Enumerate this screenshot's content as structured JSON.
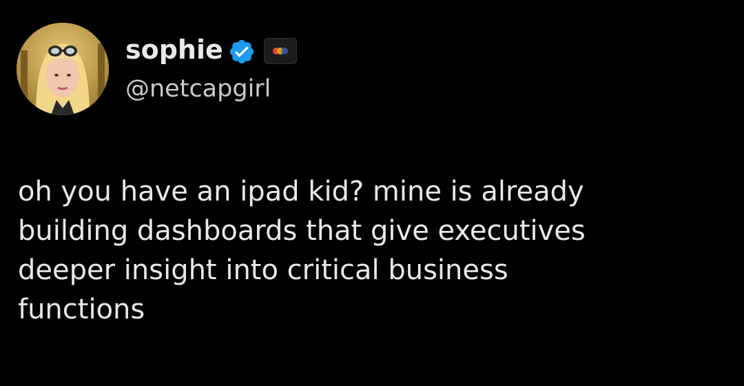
{
  "author": {
    "display_name": "sophie",
    "handle": "@netcapgirl",
    "verified": true,
    "verified_icon": "verified-badge-icon",
    "affiliate_icon": "affiliate-badge-icon",
    "avatar_icon": "profile-photo-avatar"
  },
  "tweet": {
    "lines": [
      "oh you have an ipad kid? mine is already",
      "building dashboards that give executives",
      "deeper insight into critical business",
      "functions"
    ]
  },
  "colors": {
    "background": "#000000",
    "text": "#e7e9ea",
    "handle": "#c8cccf",
    "verified_blue": "#1d9bf0"
  }
}
